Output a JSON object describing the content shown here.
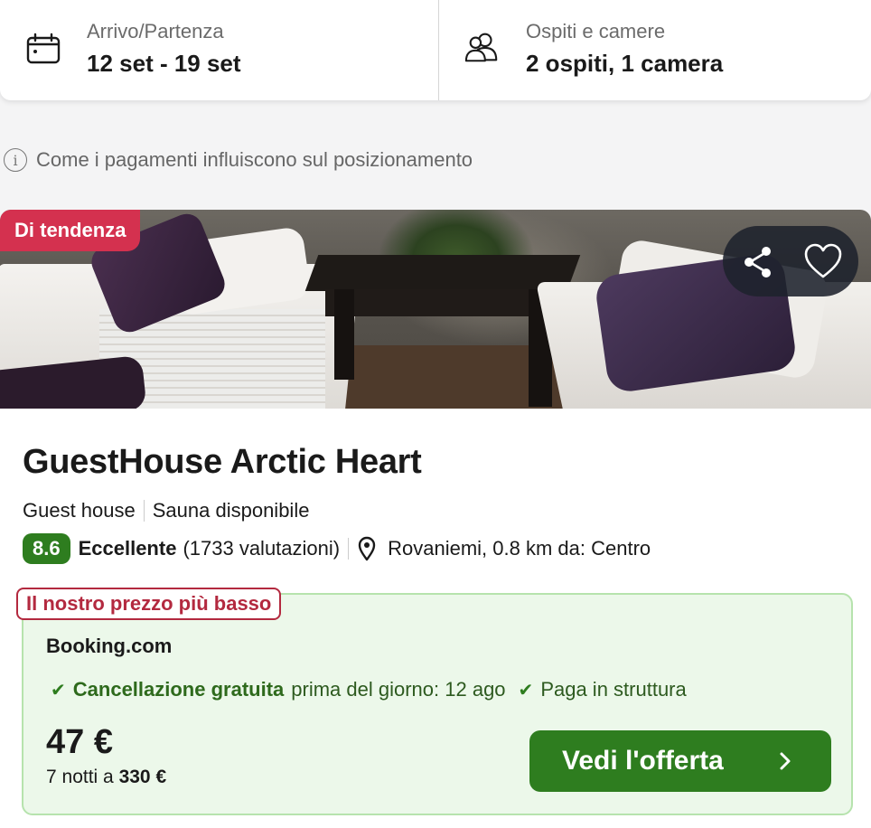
{
  "search_bar": {
    "dates": {
      "label": "Arrivo/Partenza",
      "value": "12 set - 19 set",
      "icon": "calendar-icon"
    },
    "guests": {
      "label": "Ospiti e camere",
      "value": "2 ospiti, 1 camera",
      "icon": "users-icon"
    }
  },
  "payment_note": {
    "text": "Come i pagamenti influiscono sul posizionamento",
    "icon": "info-icon"
  },
  "card": {
    "badge": "Di tendenza",
    "badge_color": "#d4314f",
    "actions": {
      "share_icon": "share-icon",
      "favorite_icon": "heart-icon"
    },
    "name": "GuestHouse Arctic Heart",
    "type": "Guest house",
    "amenity": "Sauna disponibile",
    "rating": {
      "score": "8.6",
      "word": "Eccellente",
      "count": "(1733 valutazioni)",
      "score_color": "#2e7d1f"
    },
    "location": {
      "icon": "pin-icon",
      "text": "Rovaniemi, 0.8 km da: Centro"
    },
    "offer": {
      "lowest_label": "Il nostro prezzo più basso",
      "provider": "Booking.com",
      "cancellation_bold": "Cancellazione gratuita",
      "cancellation_rest": "prima del giorno: 12 ago",
      "pay_at_property": "Paga in struttura",
      "price": "47 €",
      "nights_prefix": "7 notti a",
      "total": "330 €",
      "cta_label": "Vedi l'offerta",
      "accent_color": "#2e7d1f"
    }
  }
}
